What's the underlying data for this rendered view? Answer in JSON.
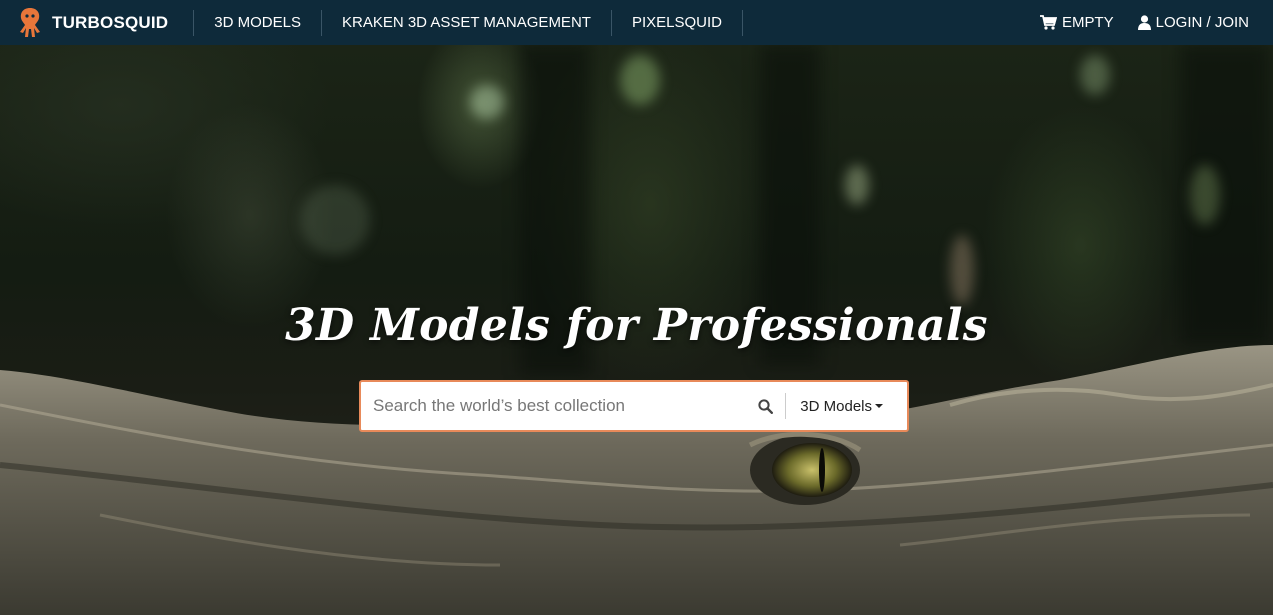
{
  "brand": {
    "name": "TURBOSQUID",
    "accent": "#e8763a"
  },
  "nav": {
    "links": [
      "3D MODELS",
      "KRAKEN 3D ASSET MANAGEMENT",
      "PIXELSQUID"
    ],
    "cart_label": "EMPTY",
    "login_label": "LOGIN / JOIN"
  },
  "hero": {
    "title": "3D Models for Professionals"
  },
  "search": {
    "placeholder": "Search the world’s best collection",
    "value": "",
    "category": "3D Models"
  },
  "icons": {
    "logo": "squid-logo-icon",
    "cart": "cart-icon",
    "user": "user-icon",
    "search": "search-icon",
    "dropdown": "caret-down-icon"
  },
  "colors": {
    "nav_bg": "#0e2a3a",
    "search_border": "#e88a5a"
  }
}
